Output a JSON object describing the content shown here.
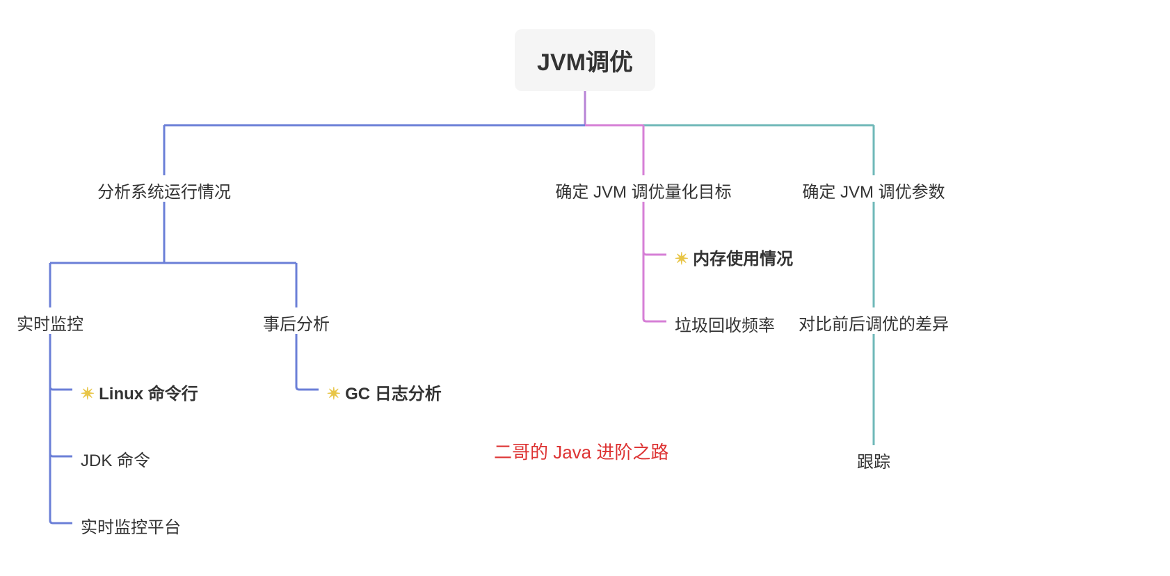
{
  "root": {
    "label": "JVM调优"
  },
  "branches": {
    "b1": {
      "label": "分析系统运行情况",
      "children": {
        "c1": {
          "label": "实时监控",
          "leaves": [
            {
              "label": "Linux 命令行",
              "star": true
            },
            {
              "label": "JDK 命令",
              "star": false
            },
            {
              "label": "实时监控平台",
              "star": false
            }
          ]
        },
        "c2": {
          "label": "事后分析",
          "leaves": [
            {
              "label": "GC 日志分析",
              "star": true
            }
          ]
        }
      }
    },
    "b2": {
      "label": "确定 JVM 调优量化目标",
      "leaves": [
        {
          "label": "内存使用情况",
          "star": true
        },
        {
          "label": "垃圾回收频率",
          "star": false
        }
      ]
    },
    "b3": {
      "label": "确定 JVM 调优参数",
      "children": {
        "c1": {
          "label": "对比前后调优的差异",
          "leaves": [
            {
              "label": "跟踪",
              "star": false
            }
          ]
        }
      }
    }
  },
  "watermark": "二哥的 Java 进阶之路",
  "colors": {
    "blue": "#6b7fd7",
    "pink": "#d67fd6",
    "teal": "#6fb8b8",
    "red": "#dd3333"
  }
}
